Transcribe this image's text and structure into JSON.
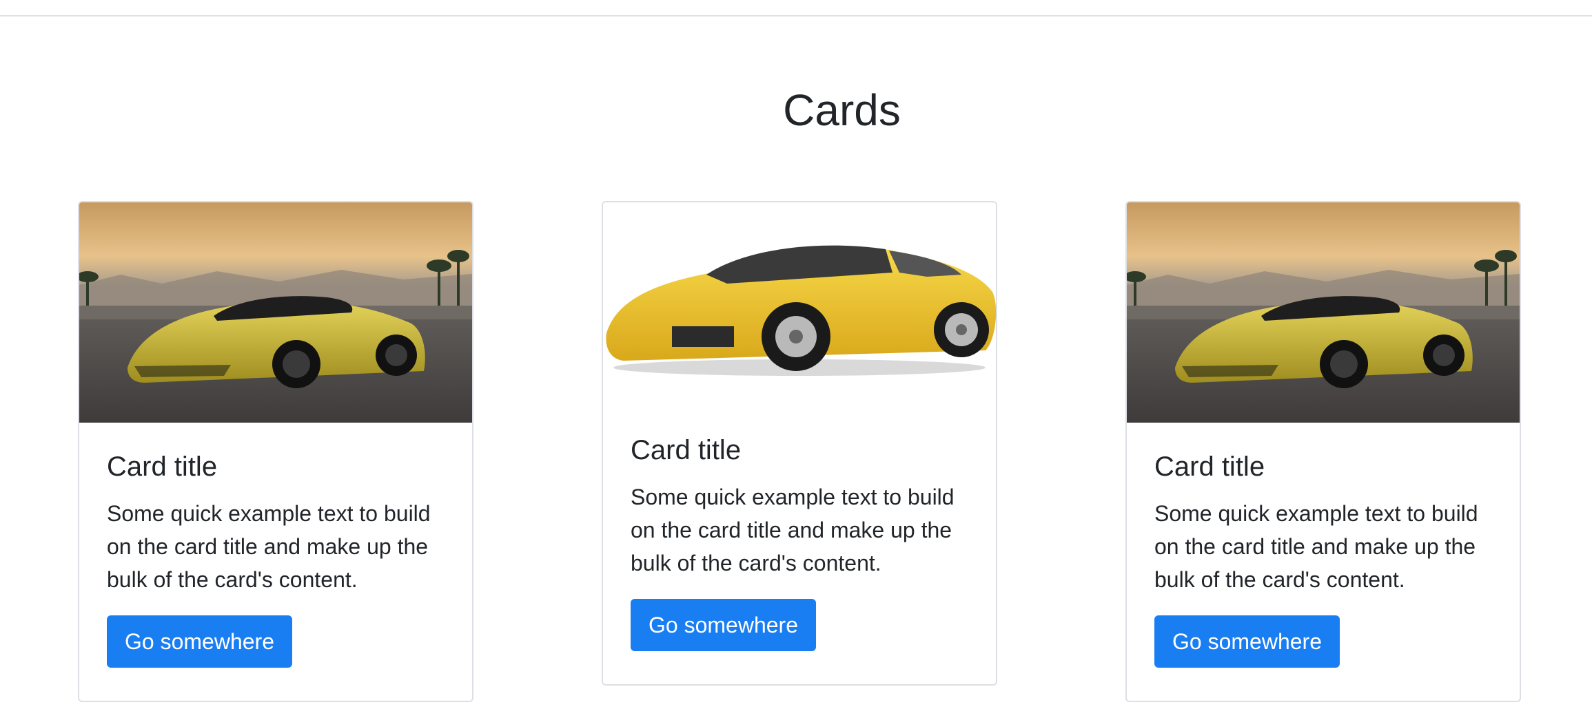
{
  "page": {
    "title": "Cards"
  },
  "cards": [
    {
      "image_name": "sports-car-on-track-image",
      "title": "Card title",
      "text": "Some quick example text to build on the card title and make up the bulk of the card's content.",
      "button_label": "Go somewhere"
    },
    {
      "image_name": "yellow-lamborghini-image",
      "title": "Card title",
      "text": "Some quick example text to build on the card title and make up the bulk of the card's content.",
      "button_label": "Go somewhere"
    },
    {
      "image_name": "sports-car-on-track-image",
      "title": "Card title",
      "text": "Some quick example text to build on the card title and make up the bulk of the card's content.",
      "button_label": "Go somewhere"
    }
  ],
  "colors": {
    "primary_button": "#1a7ef3",
    "text": "#212529",
    "card_border": "#dcdfe3",
    "car_yellow": "#d8c33a"
  }
}
